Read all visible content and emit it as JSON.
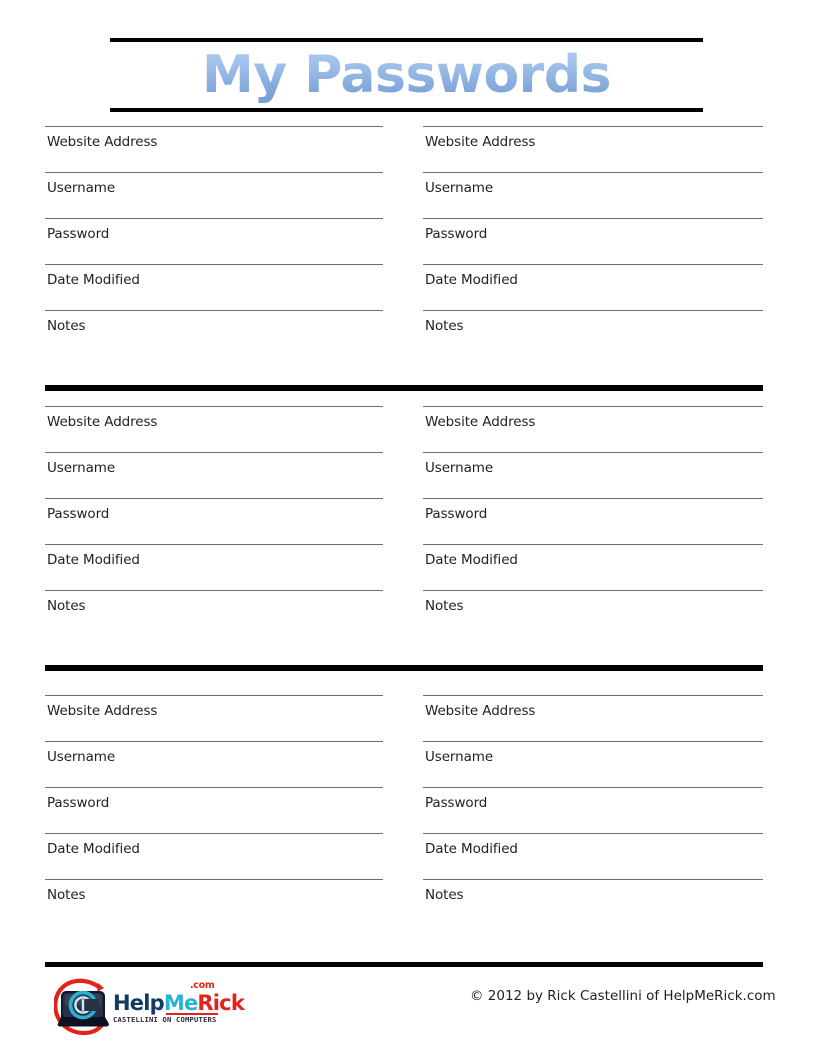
{
  "page": {
    "title": "My Passwords",
    "background_color": "#ffffff",
    "title_gradient_top": "#b9cfee",
    "title_gradient_bottom": "#6f9bd3",
    "rule_color": "#6d6e71",
    "divider_color": "#000000"
  },
  "field_labels": {
    "website_address": "Website Address",
    "username": "Username",
    "password": "Password",
    "date_modified": "Date Modified",
    "notes": "Notes"
  },
  "sections": [
    {
      "id": "entry-block-1",
      "columns": [
        {
          "id": "entry-1",
          "fields": [
            {
              "label": "Website Address",
              "value": ""
            },
            {
              "label": "Username",
              "value": ""
            },
            {
              "label": "Password",
              "value": ""
            },
            {
              "label": "Date Modified",
              "value": ""
            },
            {
              "label": "Notes",
              "value": ""
            }
          ]
        },
        {
          "id": "entry-2",
          "fields": [
            {
              "label": "Website Address",
              "value": ""
            },
            {
              "label": "Username",
              "value": ""
            },
            {
              "label": "Password",
              "value": ""
            },
            {
              "label": "Date Modified",
              "value": ""
            },
            {
              "label": "Notes",
              "value": ""
            }
          ]
        }
      ]
    },
    {
      "id": "entry-block-2",
      "columns": [
        {
          "id": "entry-3",
          "fields": [
            {
              "label": "Website Address",
              "value": ""
            },
            {
              "label": "Username",
              "value": ""
            },
            {
              "label": "Password",
              "value": ""
            },
            {
              "label": "Date Modified",
              "value": ""
            },
            {
              "label": "Notes",
              "value": ""
            }
          ]
        },
        {
          "id": "entry-4",
          "fields": [
            {
              "label": "Website Address",
              "value": ""
            },
            {
              "label": "Username",
              "value": ""
            },
            {
              "label": "Password",
              "value": ""
            },
            {
              "label": "Date Modified",
              "value": ""
            },
            {
              "label": "Notes",
              "value": ""
            }
          ]
        }
      ]
    },
    {
      "id": "entry-block-3",
      "columns": [
        {
          "id": "entry-5",
          "fields": [
            {
              "label": "Website Address",
              "value": ""
            },
            {
              "label": "Username",
              "value": ""
            },
            {
              "label": "Password",
              "value": ""
            },
            {
              "label": "Date Modified",
              "value": ""
            },
            {
              "label": "Notes",
              "value": ""
            }
          ]
        },
        {
          "id": "entry-6",
          "fields": [
            {
              "label": "Website Address",
              "value": ""
            },
            {
              "label": "Username",
              "value": ""
            },
            {
              "label": "Password",
              "value": ""
            },
            {
              "label": "Date Modified",
              "value": ""
            },
            {
              "label": "Notes",
              "value": ""
            }
          ]
        }
      ]
    }
  ],
  "footer": {
    "copyright": "© 2012 by Rick Castellini of HelpMeRick.com",
    "logo": {
      "word_part_1": "Help",
      "word_part_2": "Me",
      "word_part_3": "Rick",
      "dotcom": ".com",
      "tagline": "CASTELLINI ON COMPUTERS",
      "color_help": "#123a63",
      "color_me": "#28b3d4",
      "color_rick": "#e2231a",
      "color_swoosh": "#e2231a",
      "color_key": "#1d2433",
      "color_c": "#28b3d4"
    }
  }
}
